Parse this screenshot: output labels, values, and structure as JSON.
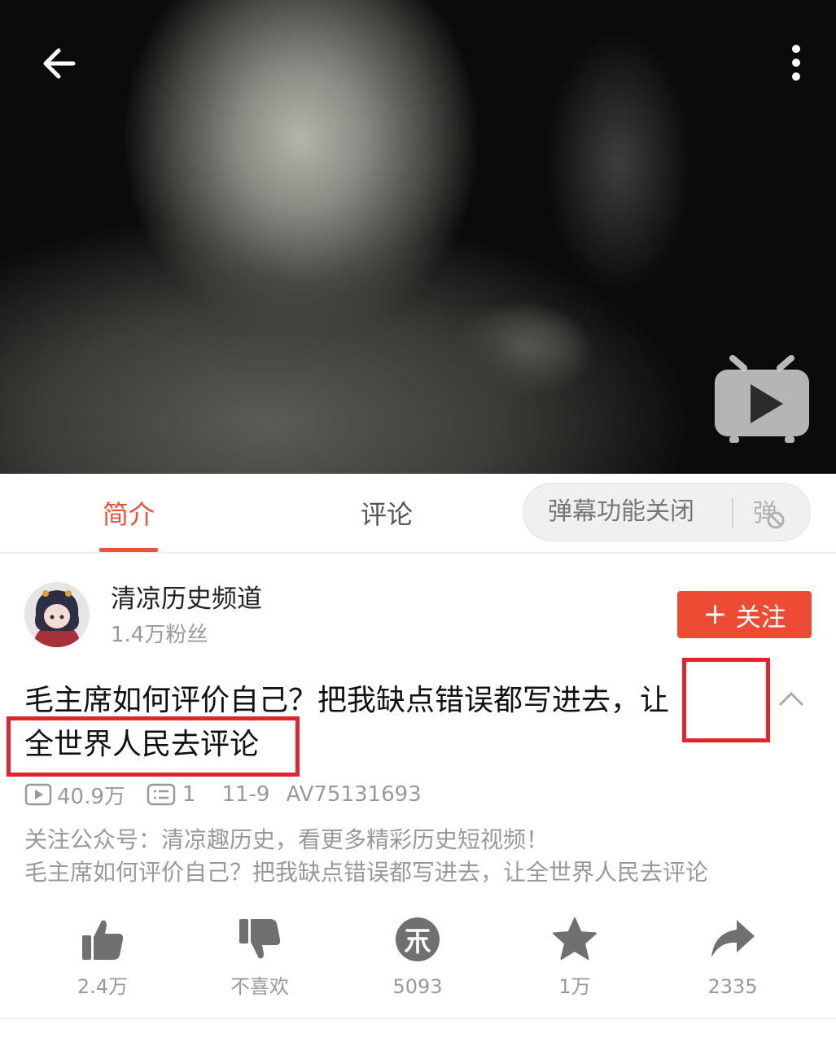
{
  "header": {
    "back_icon": "arrow-left-icon",
    "more_icon": "more-vertical-icon",
    "player_logo_icon": "tv-play-icon"
  },
  "tabs": [
    {
      "label": "简介",
      "active": true
    },
    {
      "label": "评论",
      "active": false
    }
  ],
  "danmaku": {
    "label": "弹幕功能关闭",
    "icon": "danmaku-off-icon"
  },
  "uploader": {
    "name": "清凉历史频道",
    "fans": "1.4万粉丝",
    "follow_label": "关注",
    "follow_icon": "plus-icon"
  },
  "video": {
    "title_line1": "毛主席如何评价自己？把我缺点错误都写进去，",
    "title_highlight_char": "让",
    "title_line2": "全世界人民去评论",
    "views": "40.9万",
    "danmaku_count": "1",
    "date": "11-9",
    "av_id": "AV75131693",
    "description_line1": "关注公众号：清凉趣历史，看更多精彩历史短视频！",
    "description_line2": "毛主席如何评价自己？把我缺点错误都写进去，让全世界人民去评论"
  },
  "actions": [
    {
      "icon": "thumbs-up-icon",
      "label": "2.4万"
    },
    {
      "icon": "thumbs-down-icon",
      "label": "不喜欢"
    },
    {
      "icon": "coin-icon",
      "label": "5093"
    },
    {
      "icon": "star-icon",
      "label": "1万"
    },
    {
      "icon": "share-icon",
      "label": "2335"
    }
  ],
  "colors": {
    "accent": "#e8533b",
    "follow_button": "#ee4b34",
    "highlight_box": "#e2242c",
    "secondary_text": "#999999",
    "action_icon": "#707070"
  }
}
